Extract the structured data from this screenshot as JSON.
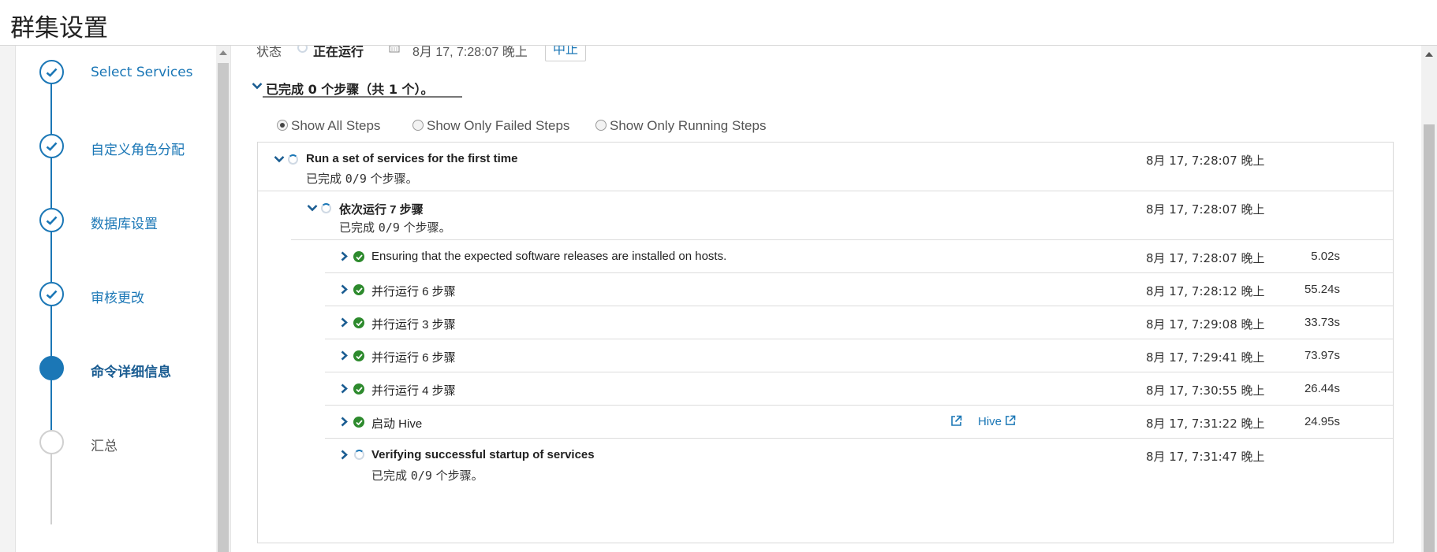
{
  "header": {
    "title": "群集设置"
  },
  "wizard": {
    "steps": [
      {
        "label": "Select Services",
        "state": "done"
      },
      {
        "label": "自定义角色分配",
        "state": "done"
      },
      {
        "label": "数据库设置",
        "state": "done"
      },
      {
        "label": "审核更改",
        "state": "done"
      },
      {
        "label": "命令详细信息",
        "state": "active"
      },
      {
        "label": "汇总",
        "state": "pending"
      }
    ]
  },
  "status": {
    "label": "状态",
    "value": "正在运行",
    "calendar_icon": "calendar-icon",
    "time": "8月 17, 7:28:07 晚上",
    "abort_button": "中止"
  },
  "summary": {
    "text": "已完成 0 个步骤（共 1 个）。"
  },
  "filters": {
    "selected": "Show All Steps",
    "options": [
      "Show All Steps",
      "Show Only Failed Steps",
      "Show Only Running Steps"
    ]
  },
  "steps": {
    "root": {
      "title": "Run a set of services for the first time",
      "sub_prefix": "已完成 ",
      "sub_count": "0/9",
      "sub_suffix": " 个步骤。",
      "time": "8月 17, 7:28:07 晚上"
    },
    "seq": {
      "title": "依次运行 7 步骤",
      "sub_prefix": "已完成 ",
      "sub_count": "0/9",
      "sub_suffix": " 个步骤。",
      "time": "8月 17, 7:28:07 晚上"
    },
    "children": [
      {
        "title": "Ensuring that the expected software releases are installed on hosts.",
        "time": "8月 17, 7:28:07 晚上",
        "duration": "5.02s"
      },
      {
        "title": "并行运行 6 步骤",
        "time": "8月 17, 7:28:12 晚上",
        "duration": "55.24s"
      },
      {
        "title": "并行运行 3 步骤",
        "time": "8月 17, 7:29:08 晚上",
        "duration": "33.73s"
      },
      {
        "title": "并行运行 6 步骤",
        "time": "8月 17, 7:29:41 晚上",
        "duration": "73.97s"
      },
      {
        "title": "并行运行 4 步骤",
        "time": "8月 17, 7:30:55 晚上",
        "duration": "26.44s"
      },
      {
        "title": "启动 Hive",
        "link": "Hive",
        "time": "8月 17, 7:31:22 晚上",
        "duration": "24.95s"
      }
    ],
    "verify": {
      "title": "Verifying successful startup of services",
      "sub_prefix": "已完成 ",
      "sub_count": "0/9",
      "sub_suffix": " 个步骤。",
      "time": "8月 17, 7:31:47 晚上"
    }
  },
  "colors": {
    "accent": "#1b77b6",
    "success": "#2d8a2d"
  }
}
